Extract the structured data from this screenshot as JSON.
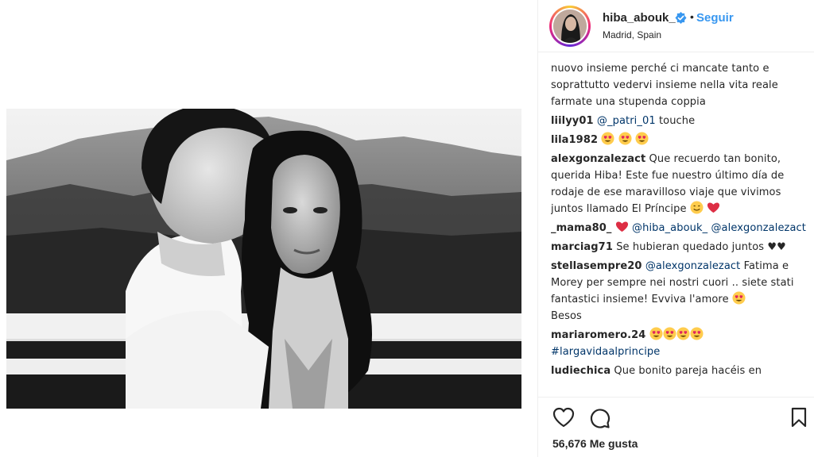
{
  "header": {
    "username": "hiba_abouk_",
    "dot": "•",
    "follow_label": "Seguir",
    "location": "Madrid, Spain"
  },
  "comments": [
    {
      "user": "",
      "text": "nuovo insieme perché ci mancate tanto e soprattutto vedervi insieme nella vita reale farmate una stupenda coppia"
    },
    {
      "user": "liilyy01",
      "mention": "@_patri_01",
      "text": " touche"
    },
    {
      "user": "lila1982",
      "text": "",
      "emojis": [
        "heart-eyes",
        "heart-eyes",
        "heart-eyes"
      ]
    },
    {
      "user": "alexgonzalezact",
      "text": "Que recuerdo tan bonito, querida Hiba! Este fue nuestro último día de rodaje de ese maravilloso viaje que vivimos juntos llamado El Príncipe",
      "emojis": [
        "smile",
        "red-heart"
      ]
    },
    {
      "user": "_mama80_",
      "emojis_before": [
        "red-heart"
      ],
      "mention": "@hiba_abouk_",
      "mention2": "@alexgonzalezact"
    },
    {
      "user": "marciag71",
      "text": "Se hubieran quedado juntos ♥♥"
    },
    {
      "user": "stellasempre20",
      "mention": "@alexgonzalezact",
      "text": " Fatima e Morey per sempre nei nostri cuori .. siete stati fantastici insieme! Evviva l'amore",
      "emojis": [
        "heart-eyes"
      ],
      "text_after": "Besos"
    },
    {
      "user": "mariaromero.24",
      "emojis": [
        "heart-eyes",
        "heart-eyes",
        "heart-eyes",
        "heart-eyes"
      ],
      "hashtag": "#largavidaalprincipe"
    },
    {
      "user": "ludiechica",
      "text": "Que bonito pareja hacéis en"
    }
  ],
  "actions": {
    "likes": "56,676 Me gusta"
  },
  "colors": {
    "link": "#003569",
    "follow": "#3897f0",
    "verified": "#3897f0"
  },
  "icons": [
    "verified-badge-icon",
    "heart-icon",
    "comment-icon",
    "bookmark-icon",
    "heart-eyes-emoji",
    "smile-emoji",
    "red-heart-emoji"
  ]
}
